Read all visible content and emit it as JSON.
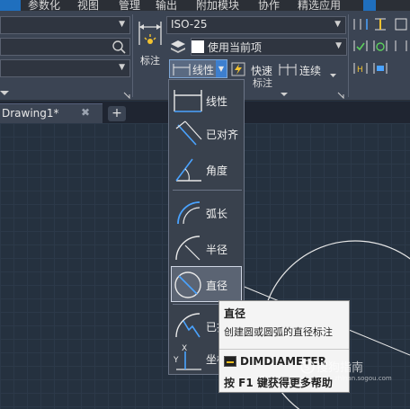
{
  "menubar": {
    "items": [
      "参数化",
      "视图",
      "管理",
      "输出",
      "附加模块",
      "协作",
      "精选应用"
    ]
  },
  "ribbon": {
    "annotate_label": "标注",
    "dim_style": "ISO-25",
    "layer_value": "使用当前项",
    "linear_label": "线性",
    "quick_label": "快速",
    "continue_label": "连续",
    "panel_label": "标注"
  },
  "tabs": {
    "document": "Drawing1*",
    "close_glyph": "✖",
    "new_glyph": "+"
  },
  "dim_menu": {
    "items": [
      {
        "label": "线性",
        "icon": "linear-dimension-icon"
      },
      {
        "label": "已对齐",
        "icon": "aligned-dimension-icon"
      },
      {
        "label": "角度",
        "icon": "angular-dimension-icon"
      },
      {
        "label": "弧长",
        "icon": "arc-length-icon"
      },
      {
        "label": "半径",
        "icon": "radius-dimension-icon"
      },
      {
        "label": "直径",
        "icon": "diameter-dimension-icon"
      },
      {
        "label": "已折",
        "icon": "jogged-dimension-icon"
      },
      {
        "label": "坐标",
        "icon": "ordinate-dimension-icon"
      }
    ],
    "selected": "直径"
  },
  "tooltip": {
    "title": "直径",
    "description": "创建圆或圆弧的直径标注",
    "command": "DIMDIAMETER",
    "help": "按 F1 键获得更多帮助"
  },
  "watermark": {
    "text": "搜狗指南",
    "url": "zhinan.sogou.com"
  },
  "colors": {
    "ribbon_bg": "#3b4453",
    "canvas_bg": "#25313f",
    "accent": "#3d7fcf",
    "menu_bg": "#39414d",
    "tooltip_bg": "#f4f4f4"
  }
}
